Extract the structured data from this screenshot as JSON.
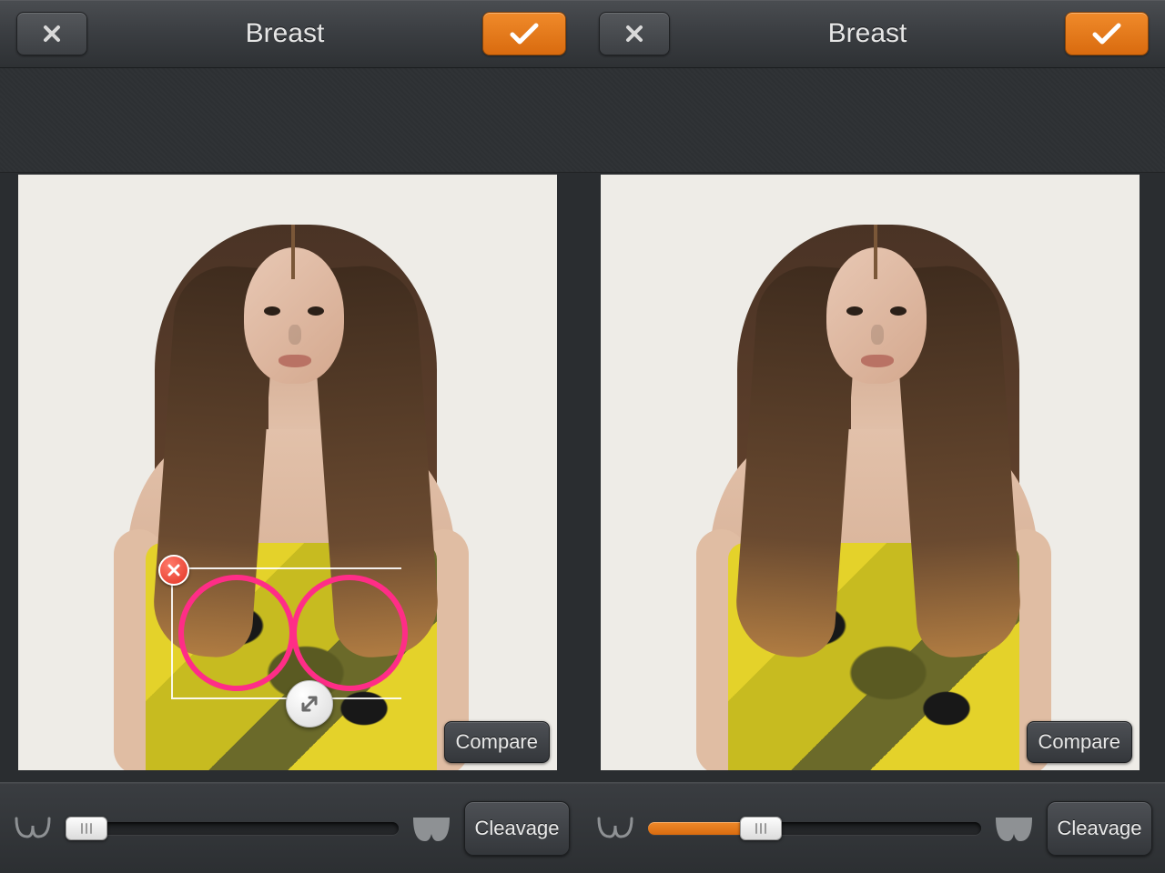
{
  "panes": [
    {
      "title": "Breast",
      "compare_label": "Compare",
      "cleavage_label": "Cleavage",
      "slider_value": 0,
      "show_selection_overlay": true
    },
    {
      "title": "Breast",
      "compare_label": "Compare",
      "cleavage_label": "Cleavage",
      "slider_value": 34,
      "show_selection_overlay": false
    }
  ],
  "colors": {
    "accent_orange": "#e77817",
    "selection_pink": "#ff2d87"
  }
}
